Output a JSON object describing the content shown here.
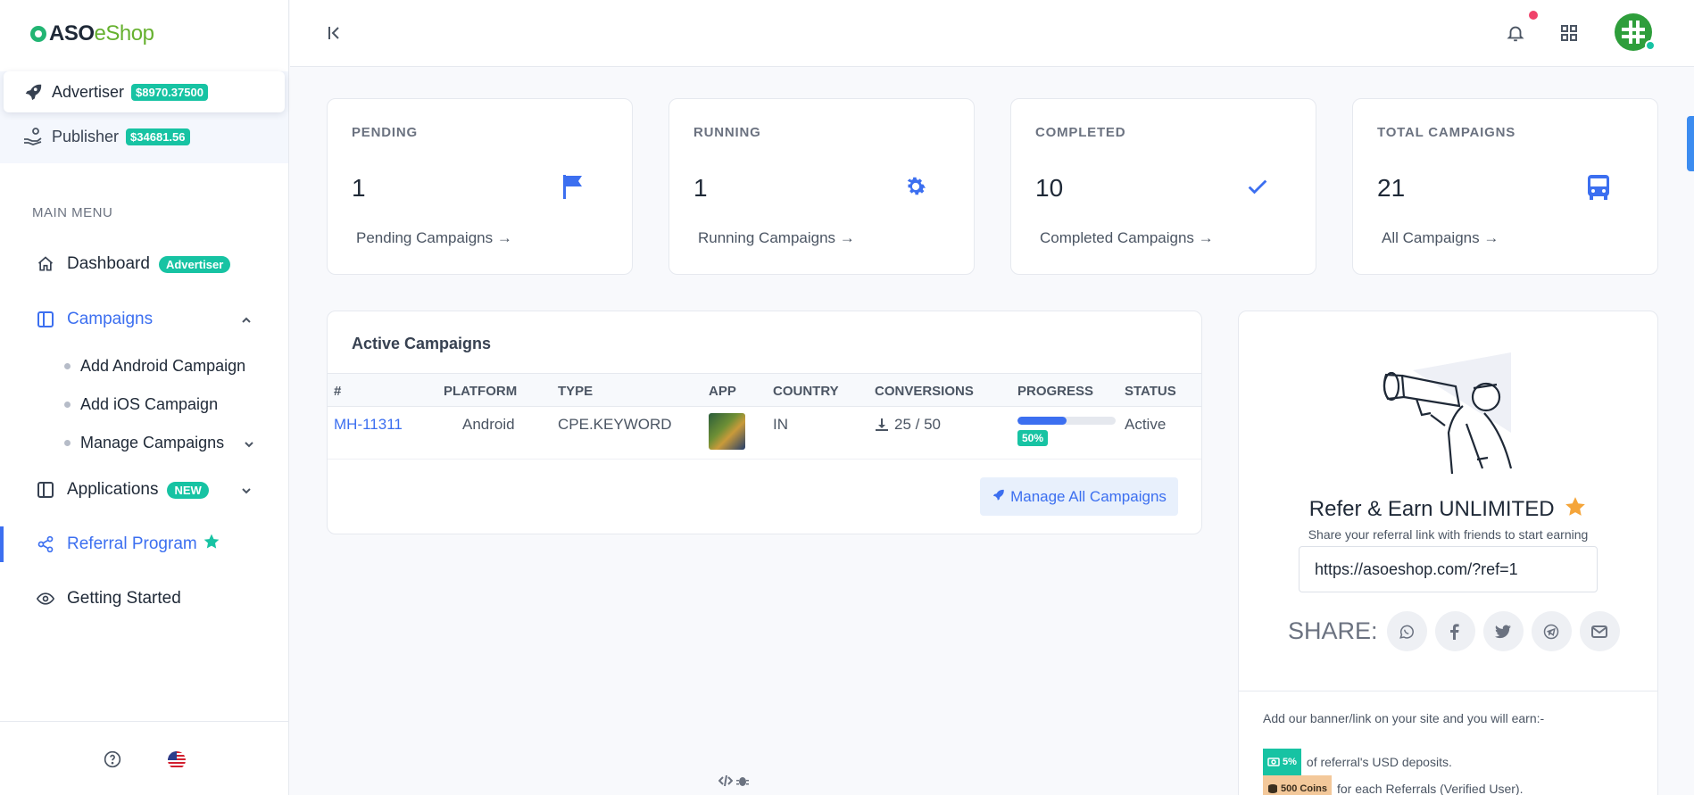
{
  "brand": {
    "part1": "ASO",
    "part2": "eShop"
  },
  "accounts": [
    {
      "label": "Advertiser",
      "balance": "$8970.37500"
    },
    {
      "label": "Publisher",
      "balance": "$34681.56"
    }
  ],
  "menu": {
    "heading": "MAIN MENU",
    "dashboard": {
      "label": "Dashboard",
      "badge": "Advertiser"
    },
    "campaigns": {
      "label": "Campaigns"
    },
    "sub": [
      "Add Android Campaign",
      "Add iOS Campaign",
      "Manage Campaigns"
    ],
    "applications": {
      "label": "Applications",
      "badge": "NEW"
    },
    "referral": {
      "label": "Referral Program"
    },
    "getting_started": {
      "label": "Getting Started"
    }
  },
  "stats": [
    {
      "label": "PENDING",
      "value": "1",
      "link": "Pending Campaigns →",
      "icon": "flag-icon"
    },
    {
      "label": "RUNNING",
      "value": "1",
      "link": "Running Campaigns →",
      "icon": "gear-icon"
    },
    {
      "label": "COMPLETED",
      "value": "10",
      "link": "Completed Campaigns →",
      "icon": "check-icon"
    },
    {
      "label": "TOTAL CAMPAIGNS",
      "value": "21",
      "link": "All Campaigns →",
      "icon": "bus-icon"
    }
  ],
  "active_campaigns": {
    "title": "Active Campaigns",
    "columns": [
      "#",
      "PLATFORM",
      "TYPE",
      "APP",
      "COUNTRY",
      "CONVERSIONS",
      "PROGRESS",
      "STATUS"
    ],
    "rows": [
      {
        "id": "MH-11311",
        "platform": "Android",
        "type": "CPE.KEYWORD",
        "country": "IN",
        "conversions": "25 / 50",
        "progress": 0.5,
        "progress_label": "50%",
        "status": "Active"
      }
    ],
    "manage_button": "Manage All Campaigns"
  },
  "referral": {
    "title": "Refer & Earn UNLIMITED",
    "subtitle": "Share your referral link with friends to start earning",
    "link": "https://asoeshop.com/?ref=1",
    "share_label": "SHARE:",
    "share_buttons": [
      "whatsapp-icon",
      "facebook-icon",
      "twitter-icon",
      "telegram-icon",
      "mail-icon"
    ],
    "earn_intro": "Add our banner/link on your site and you will earn:-",
    "lines": [
      {
        "pill": "5%",
        "text": "of referral's USD deposits."
      },
      {
        "pill": "500 Coins",
        "text": "for each Referrals (Verified User)."
      }
    ]
  },
  "colors": {
    "accent": "#3c6ff0",
    "teal": "#17c3a3",
    "brand_green": "#66b12f"
  }
}
